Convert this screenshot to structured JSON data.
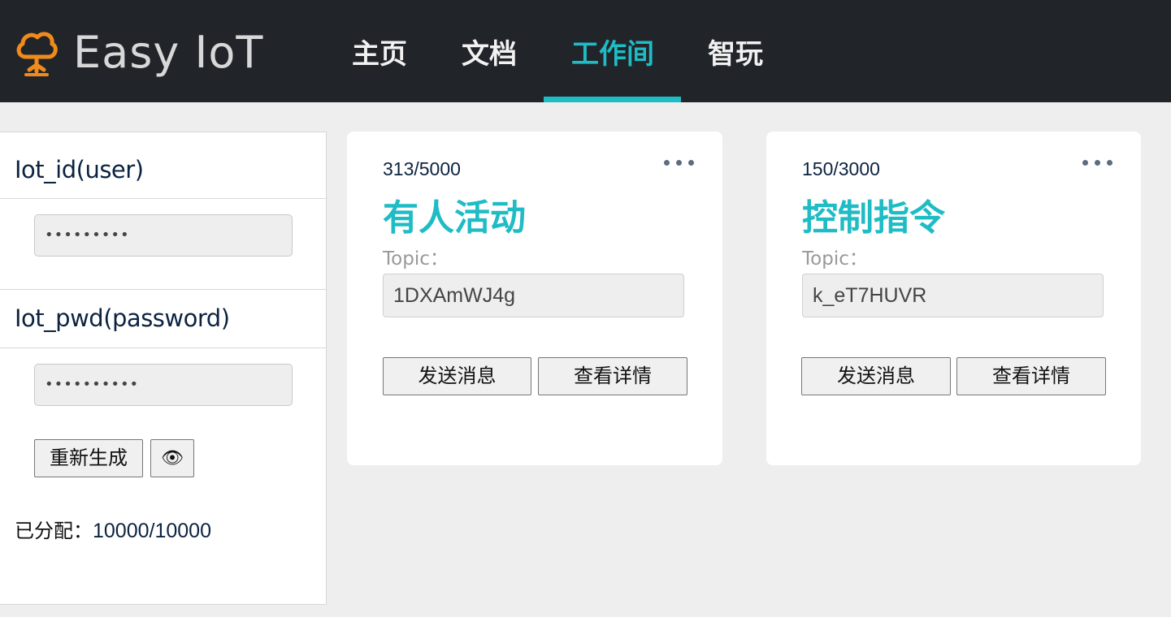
{
  "header": {
    "brand": "Easy IoT",
    "nav": [
      {
        "label": "主页",
        "active": false
      },
      {
        "label": "文档",
        "active": false
      },
      {
        "label": "工作间",
        "active": true
      },
      {
        "label": "智玩",
        "active": false
      }
    ],
    "accent_color": "#1fbcc5",
    "logo_icon": "cloud-tree-icon"
  },
  "credentials": {
    "id_label": "Iot_id(user)",
    "id_value": "•••••••••",
    "pwd_label": "Iot_pwd(password)",
    "pwd_value": "••••••••••",
    "regenerate_label": "重新生成",
    "reveal_icon": "👁",
    "allocated_label": "已分配：",
    "allocated_value": "10000/10000"
  },
  "cards": [
    {
      "quota": "313/5000",
      "title": "有人活动",
      "topic_label": "Topic：",
      "topic_value": "1DXAmWJ4g",
      "send_label": "发送消息",
      "details_label": "查看详情"
    },
    {
      "quota": "150/3000",
      "title": "控制指令",
      "topic_label": "Topic：",
      "topic_value": "k_eT7HUVR",
      "send_label": "发送消息",
      "details_label": "查看详情"
    }
  ]
}
